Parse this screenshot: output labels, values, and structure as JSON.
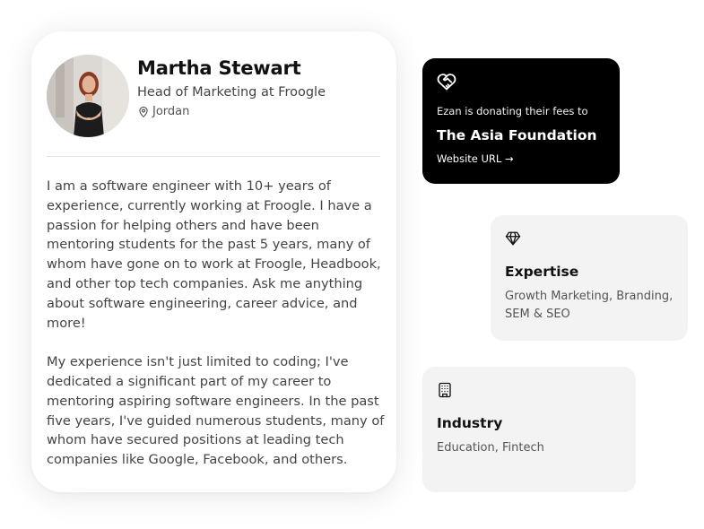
{
  "profile": {
    "name": "Martha Stewart",
    "role": "Head of Marketing at Froogle",
    "location": "Jordan",
    "bio": [
      "I am a software engineer with 10+ years of experience, currently working at Froogle. I have a passion for helping others and have been mentoring students for the past 5 years, many of whom have gone on to work at Froogle, Headbook, and other top tech companies. Ask me anything about software engineering, career advice, and more!",
      "My experience isn't just limited to coding; I've dedicated a significant part of my career to mentoring aspiring software engineers. In the past five years, I've guided numerous students, many of whom have secured positions at leading tech companies like Google, Facebook, and others."
    ]
  },
  "donation": {
    "icon": "heart-handshake-icon",
    "text": "Ezan is donating their fees to",
    "organization": "The Asia Foundation",
    "link_label": "Website URL →"
  },
  "expertise": {
    "icon": "diamond-icon",
    "title": "Expertise",
    "value": "Growth Marketing, Branding, SEM & SEO"
  },
  "industry": {
    "icon": "building-icon",
    "title": "Industry",
    "value": "Education, Fintech"
  },
  "colors": {
    "donation_card_bg": "#000000",
    "info_card_bg": "#f3f3f3",
    "text_primary": "#111111",
    "text_secondary": "#444444"
  }
}
